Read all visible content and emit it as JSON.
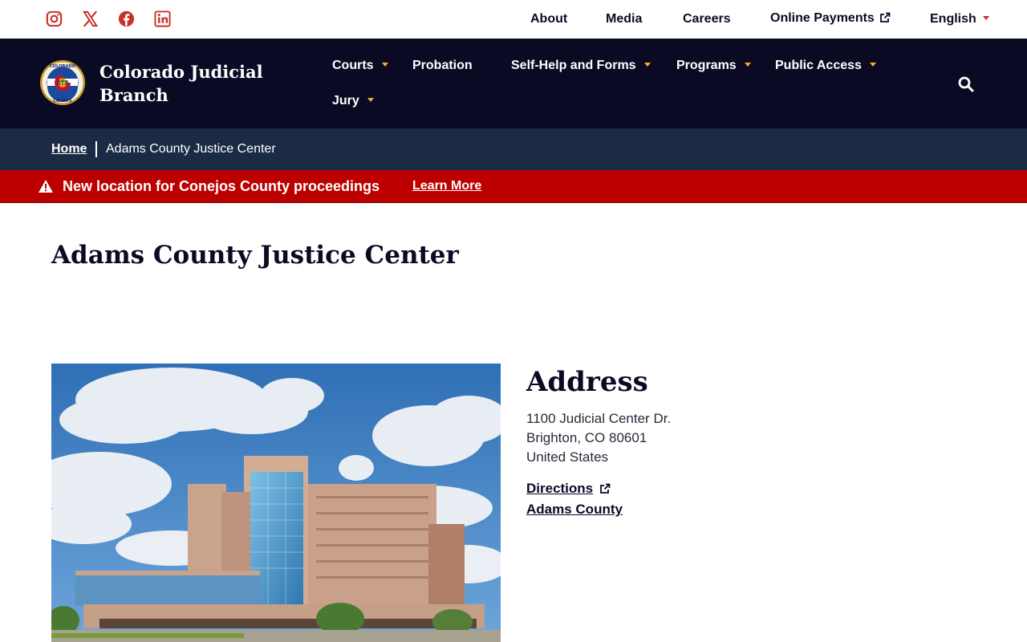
{
  "colors": {
    "navy": "#0b0a24",
    "crumb_bg": "#1b2b45",
    "alert_red": "#bc0000",
    "accent_gold": "#f6b21a",
    "social_red": "#c8312c"
  },
  "social": [
    {
      "name": "instagram-icon"
    },
    {
      "name": "x-twitter-icon"
    },
    {
      "name": "facebook-icon"
    },
    {
      "name": "linkedin-icon"
    }
  ],
  "utility": {
    "about": "About",
    "media": "Media",
    "careers": "Careers",
    "online_payments": "Online Payments",
    "language": "English"
  },
  "header": {
    "site_name": "Colorado Judicial Branch",
    "nav": {
      "courts": "Courts",
      "probation": "Probation",
      "self_help": "Self-Help and Forms",
      "programs": "Programs",
      "public_access": "Public Access",
      "jury": "Jury"
    }
  },
  "breadcrumb": {
    "home": "Home",
    "current": "Adams County Justice Center"
  },
  "alert": {
    "message": "New location for Conejos County proceedings",
    "link": "Learn More"
  },
  "main": {
    "title": "Adams County Justice Center",
    "address": {
      "heading": "Address",
      "line1": "1100 Judicial Center Dr.",
      "line2": "Brighton, CO 80601",
      "line3": "United States",
      "directions": "Directions",
      "county": "Adams County"
    }
  }
}
